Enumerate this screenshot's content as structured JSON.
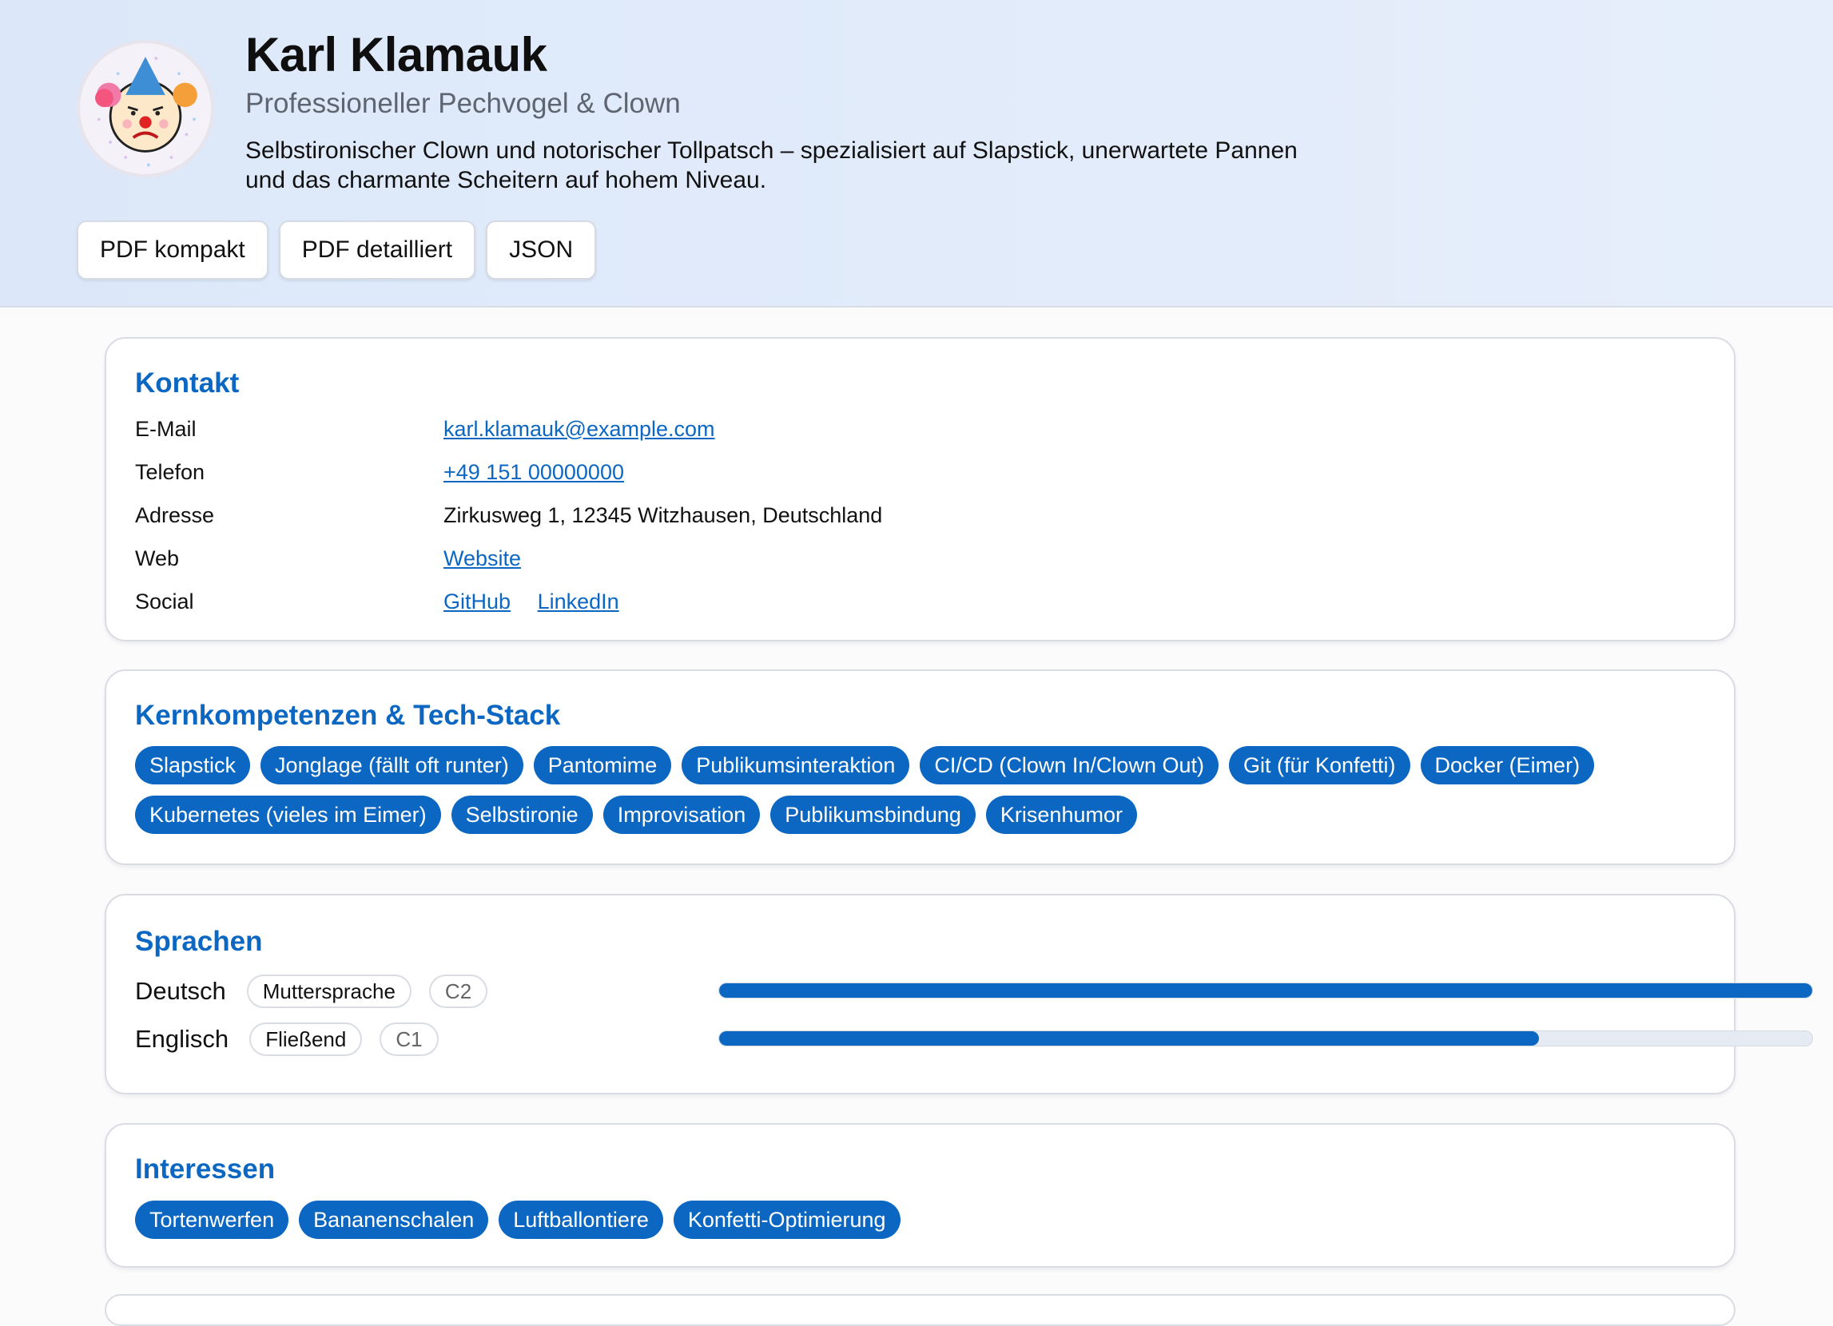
{
  "header": {
    "name": "Karl Klamauk",
    "role": "Professioneller Pechvogel & Clown",
    "bio": "Selbstironischer Clown und notorischer Tollpatsch – spezialisiert auf Slapstick, unerwartete Pannen und das charmante Scheitern auf hohem Niveau.",
    "avatar_icon": "clown-avatar-icon",
    "buttons": [
      "PDF kompakt",
      "PDF detailliert",
      "JSON"
    ]
  },
  "contact": {
    "title": "Kontakt",
    "email_label": "E-Mail",
    "email": "karl.klamauk@example.com",
    "phone_label": "Telefon",
    "phone": "+49 151 00000000",
    "address_label": "Adresse",
    "address": "Zirkusweg 1, 12345 Witzhausen, Deutschland",
    "web_label": "Web",
    "web": "Website",
    "social_label": "Social",
    "social": [
      "GitHub",
      "LinkedIn"
    ]
  },
  "skills": {
    "title": "Kernkompetenzen & Tech-Stack",
    "items": [
      "Slapstick",
      "Jonglage (fällt oft runter)",
      "Pantomime",
      "Publikumsinteraktion",
      "CI/CD (Clown In/Clown Out)",
      "Git (für Konfetti)",
      "Docker (Eimer)",
      "Kubernetes (vieles im Eimer)",
      "Selbstironie",
      "Improvisation",
      "Publikumsbindung",
      "Krisenhumor"
    ]
  },
  "languages": {
    "title": "Sprachen",
    "items": [
      {
        "name": "Deutsch",
        "level_text": "Muttersprache",
        "cefr": "C2",
        "proficiency": 1.0
      },
      {
        "name": "Englisch",
        "level_text": "Fließend",
        "cefr": "C1",
        "proficiency": 0.75
      }
    ]
  },
  "interests": {
    "title": "Interessen",
    "items": [
      "Tortenwerfen",
      "Bananenschalen",
      "Luftballontiere",
      "Konfetti-Optimierung"
    ]
  },
  "colors": {
    "accent": "#0b67c2",
    "header_bg": "#dce8f9",
    "chip_text": "#ffffff",
    "bar_track": "#e6ebf3"
  }
}
